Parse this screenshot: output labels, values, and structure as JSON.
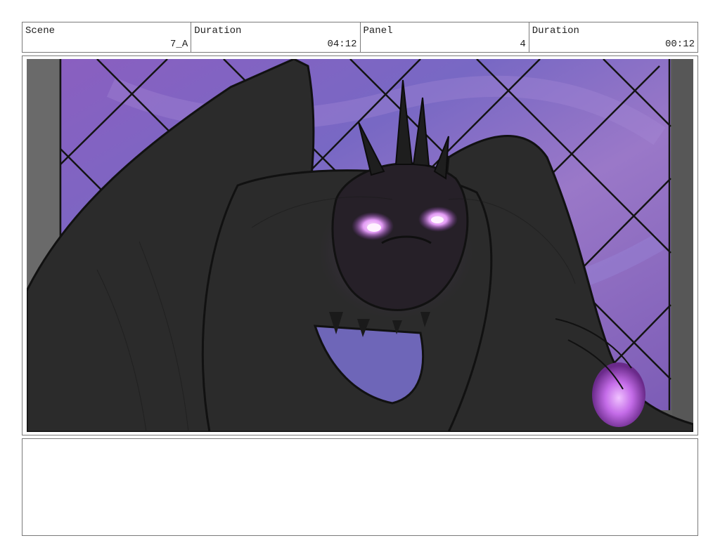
{
  "header": {
    "scene_label": "Scene",
    "scene_value": "7_A",
    "duration_label": "Duration",
    "duration_value": "04:12",
    "panel_label": "Panel",
    "panel_value": "4",
    "panel_duration_label": "Duration",
    "panel_duration_value": "00:12"
  },
  "panel_image": {
    "colors": {
      "sky_purple": "#7a5bb8",
      "sky_blue": "#8a8ad0",
      "sky_pink": "#b07ac8",
      "wall_gray": "#5a5a5a",
      "creature_dark": "#2a2a2a",
      "eye_glow": "#f2b6ff",
      "orb_glow": "#c878f0"
    }
  },
  "notes": {
    "text": ""
  }
}
